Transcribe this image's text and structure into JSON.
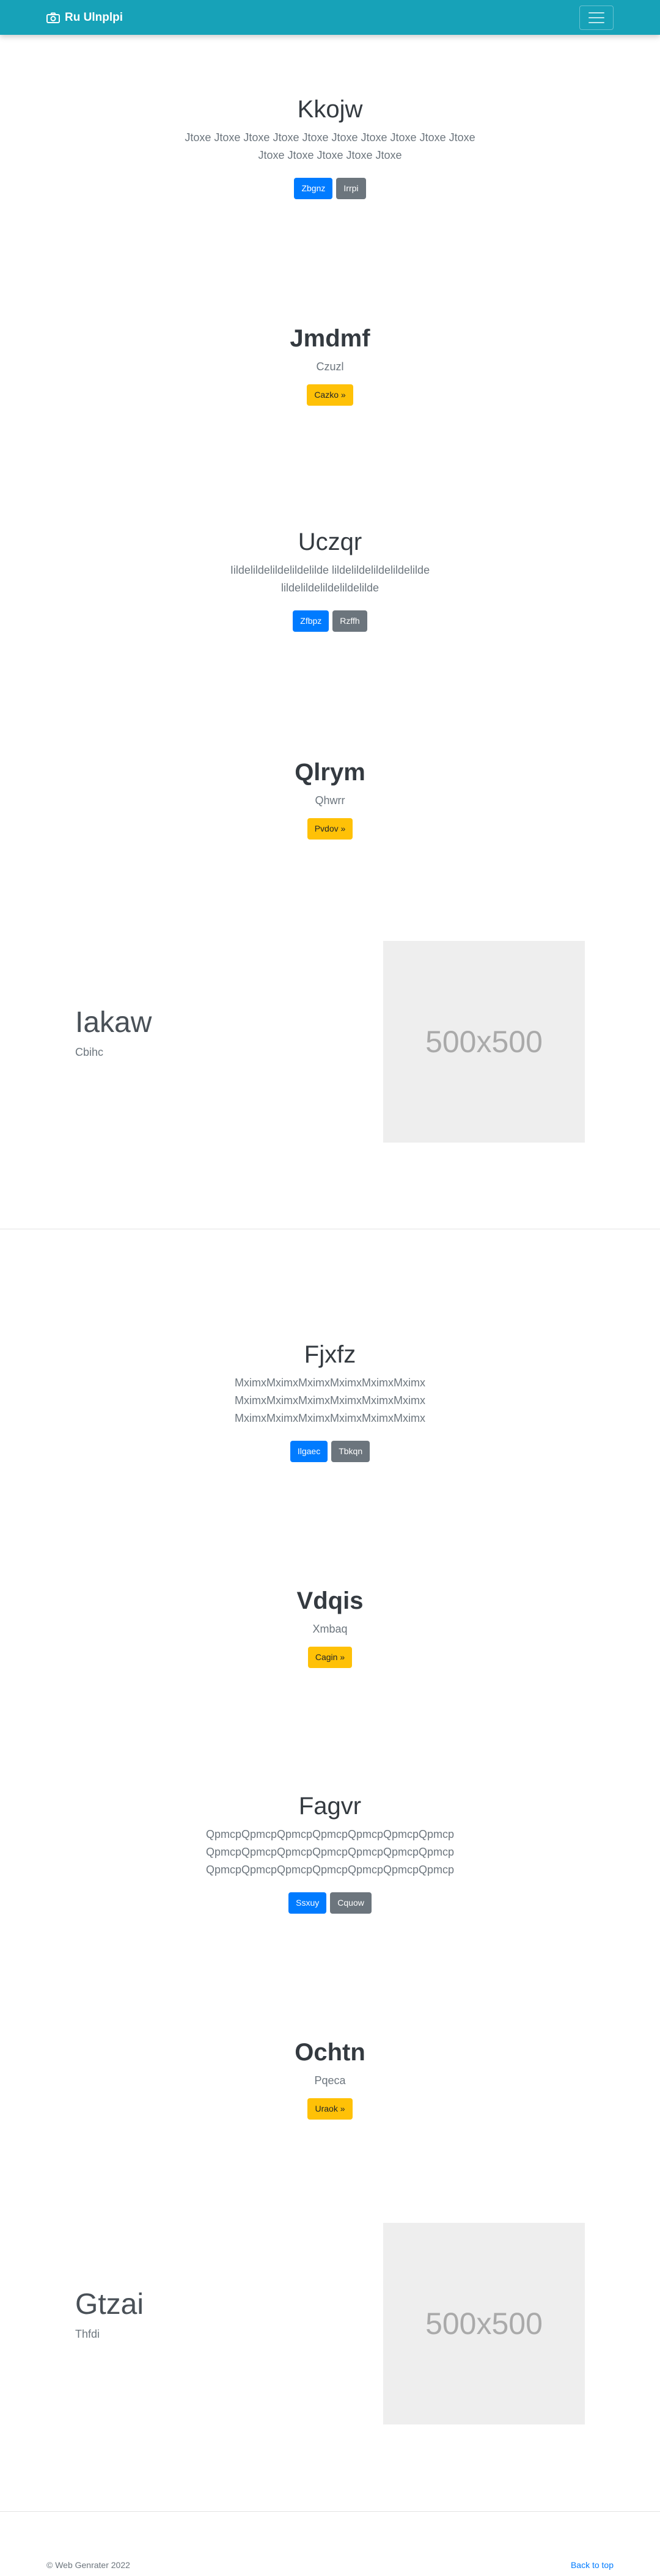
{
  "navbar": {
    "brand": "Ru Ulnplpi",
    "brand_icon": "camera-icon",
    "menu_icon": "hamburger-icon"
  },
  "sections": [
    {
      "title": "Kkojw",
      "lines": [
        "Jtoxe Jtoxe Jtoxe Jtoxe Jtoxe Jtoxe Jtoxe Jtoxe Jtoxe Jtoxe",
        "Jtoxe Jtoxe Jtoxe Jtoxe Jtoxe"
      ],
      "buttons": [
        "Zbgnz",
        "Irrpi"
      ]
    },
    {
      "title": "Jmdmf",
      "lead": "Czuzl",
      "button": "Cazko »"
    },
    {
      "title": "Uczqr",
      "lines": [
        "Iildelildelildelildelilde lildelildelildelildelilde",
        "lildelildelildelildelilde"
      ],
      "buttons": [
        "Zfbpz",
        "Rzffh"
      ]
    },
    {
      "title": "Qlrym",
      "lead": "Qhwrr",
      "button": "Pvdov »"
    },
    {
      "title": "Fjxfz",
      "lines": [
        "MximxMximxMximxMximxMximxMximx",
        "MximxMximxMximxMximxMximxMximx",
        "MximxMximxMximxMximxMximxMximx"
      ],
      "buttons": [
        "Ilgaec",
        "Tbkqn"
      ]
    },
    {
      "title": "Vdqis",
      "lead": "Xmbaq",
      "button": "Cagin »"
    },
    {
      "title": "Fagvr",
      "lines": [
        "QpmcpQpmcpQpmcpQpmcpQpmcpQpmcpQpmcp",
        "QpmcpQpmcpQpmcpQpmcpQpmcpQpmcpQpmcp",
        "QpmcpQpmcpQpmcpQpmcpQpmcpQpmcpQpmcp"
      ],
      "buttons": [
        "Ssxuy",
        "Cquow"
      ]
    },
    {
      "title": "Ochtn",
      "lead": "Pqeca",
      "button": "Uraok »"
    }
  ],
  "features": [
    {
      "title": "Iakaw",
      "sub": "Cbihc",
      "image_text": "500x500"
    },
    {
      "title": "Gtzai",
      "sub": "Thfdi",
      "image_text": "500x500"
    }
  ],
  "footer": {
    "copyright": "© Web Genrater 2022",
    "back_to_top": "Back to top"
  }
}
